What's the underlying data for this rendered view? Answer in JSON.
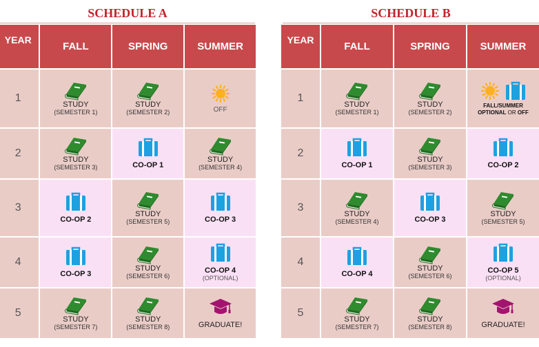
{
  "schedule_a": {
    "title": "SCHEDULE A",
    "headers": {
      "year": "YEAR",
      "fall": "FALL",
      "spring": "SPRING",
      "summer": "SUMMER"
    },
    "rows": [
      {
        "year": "1",
        "fall": {
          "kind": "study",
          "label": "STUDY",
          "sub": "(SEMESTER 1)"
        },
        "spring": {
          "kind": "study",
          "label": "STUDY",
          "sub": "(SEMESTER 2)"
        },
        "summer": {
          "kind": "off",
          "label": "OFF"
        }
      },
      {
        "year": "2",
        "fall": {
          "kind": "study",
          "label": "STUDY",
          "sub": "(SEMESTER 3)"
        },
        "spring": {
          "kind": "coop",
          "label": "CO-OP 1"
        },
        "summer": {
          "kind": "study",
          "label": "STUDY",
          "sub": "(SEMESTER 4)"
        }
      },
      {
        "year": "3",
        "fall": {
          "kind": "coop",
          "label": "CO-OP 2"
        },
        "spring": {
          "kind": "study",
          "label": "STUDY",
          "sub": "(SEMESTER 5)"
        },
        "summer": {
          "kind": "coop",
          "label": "CO-OP 3"
        }
      },
      {
        "year": "4",
        "fall": {
          "kind": "coop",
          "label": "CO-OP 3"
        },
        "spring": {
          "kind": "study",
          "label": "STUDY",
          "sub": "(SEMESTER 6)"
        },
        "summer": {
          "kind": "coop",
          "label": "CO-OP 4",
          "sub": "(OPTIONAL)"
        }
      },
      {
        "year": "5",
        "fall": {
          "kind": "study",
          "label": "STUDY",
          "sub": "(SEMESTER 7)"
        },
        "spring": {
          "kind": "study",
          "label": "STUDY",
          "sub": "(SEMESTER 8)"
        },
        "summer": {
          "kind": "grad",
          "label": "GRADUATE!"
        }
      }
    ]
  },
  "schedule_b": {
    "title": "SCHEDULE B",
    "headers": {
      "year": "YEAR",
      "fall": "FALL",
      "spring": "SPRING",
      "summer": "SUMMER"
    },
    "rows": [
      {
        "year": "1",
        "fall": {
          "kind": "study",
          "label": "STUDY",
          "sub": "(SEMESTER 1)"
        },
        "spring": {
          "kind": "study",
          "label": "STUDY",
          "sub": "(SEMESTER 2)"
        },
        "summer": {
          "kind": "choice",
          "line1": "FALL/SUMMER",
          "line2_bold": "OPTIONAL",
          "line2_mid": " OR ",
          "line2_end": "OFF"
        }
      },
      {
        "year": "2",
        "fall": {
          "kind": "coop",
          "label": "CO-OP 1"
        },
        "spring": {
          "kind": "study",
          "label": "STUDY",
          "sub": "(SEMESTER 3)"
        },
        "summer": {
          "kind": "coop",
          "label": "CO-OP 2"
        }
      },
      {
        "year": "3",
        "fall": {
          "kind": "study",
          "label": "STUDY",
          "sub": "(SEMESTER 4)"
        },
        "spring": {
          "kind": "coop",
          "label": "CO-OP 3"
        },
        "summer": {
          "kind": "study",
          "label": "STUDY",
          "sub": "(SEMESTER 5)"
        }
      },
      {
        "year": "4",
        "fall": {
          "kind": "coop",
          "label": "CO-OP 4"
        },
        "spring": {
          "kind": "study",
          "label": "STUDY",
          "sub": "(SEMESTER 6)"
        },
        "summer": {
          "kind": "coop",
          "label": "CO-OP 5",
          "sub": "(OPTIONAL)"
        }
      },
      {
        "year": "5",
        "fall": {
          "kind": "study",
          "label": "STUDY",
          "sub": "(SEMESTER 7)"
        },
        "spring": {
          "kind": "study",
          "label": "STUDY",
          "sub": "(SEMESTER 8)"
        },
        "summer": {
          "kind": "grad",
          "label": "GRADUATE!"
        }
      }
    ]
  },
  "icons": {
    "study": "book-icon",
    "coop": "briefcase-icon",
    "off": "sun-icon",
    "grad": "graduation-cap-icon"
  },
  "colors": {
    "title": "#c0242c",
    "header_bg": "#c8494b",
    "study_cell_bg": "#eaccc7",
    "coop_cell_bg": "#fae0f5",
    "book": "#2e8b2e",
    "briefcase": "#1da1e0",
    "sun": "#ffb020",
    "grad_cap": "#a3146f"
  }
}
